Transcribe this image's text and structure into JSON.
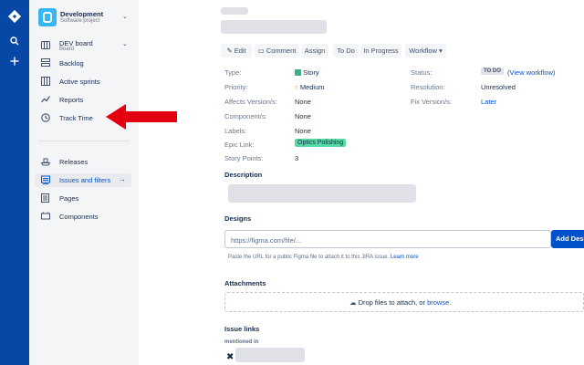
{
  "project": {
    "name": "Development",
    "type": "Software project"
  },
  "sidebar": {
    "board": {
      "name": "DEV board",
      "sub": "Board"
    },
    "items_top": [
      {
        "label": "Backlog",
        "icon": "backlog-icon"
      },
      {
        "label": "Active sprints",
        "icon": "active-sprints-icon"
      },
      {
        "label": "Reports",
        "icon": "reports-icon"
      },
      {
        "label": "Track Time",
        "icon": "clock-icon"
      }
    ],
    "items_bottom": [
      {
        "label": "Releases",
        "icon": "ship-icon"
      },
      {
        "label": "Issues and filters",
        "icon": "issues-icon",
        "active": true
      },
      {
        "label": "Pages",
        "icon": "page-icon"
      },
      {
        "label": "Components",
        "icon": "components-icon"
      }
    ]
  },
  "toolbar": {
    "edit": "Edit",
    "comment": "Comment",
    "assign": "Assign",
    "todo": "To Do",
    "in_progress": "In Progress",
    "workflow": "Workflow"
  },
  "details": {
    "type_label": "Type:",
    "type_value": "Story",
    "priority_label": "Priority:",
    "priority_value": "Medium",
    "affects_label": "Affects Version/s:",
    "affects_value": "None",
    "components_label": "Component/s:",
    "components_value": "None",
    "labels_label": "Labels:",
    "labels_value": "None",
    "epic_label": "Epic Link:",
    "epic_value": "Optics Polishing",
    "points_label": "Story Points:",
    "points_value": "3",
    "status_label": "Status:",
    "status_value": "TO DO",
    "view_workflow": "(View workflow)",
    "resolution_label": "Resolution:",
    "resolution_value": "Unresolved",
    "fix_label": "Fix Version/s:",
    "fix_value": "Later"
  },
  "description": {
    "title": "Description"
  },
  "designs": {
    "title": "Designs",
    "placeholder": "https://figma.com/file/...",
    "add_button": "Add Design",
    "help": "Paste the URL for a public Figma file to attach it to this JIRA issue.",
    "learn_more": "Learn more"
  },
  "attachments": {
    "title": "Attachments",
    "drop_text": "Drop files to attach, or",
    "browse": "browse."
  },
  "issue_links": {
    "title": "Issue links",
    "relation": "mentioned in"
  },
  "colors": {
    "global_nav": "#0747a6",
    "accent": "#0052cc",
    "arrow": "#e3000f",
    "story": "#36b37e",
    "priority": "#ff8b00"
  }
}
